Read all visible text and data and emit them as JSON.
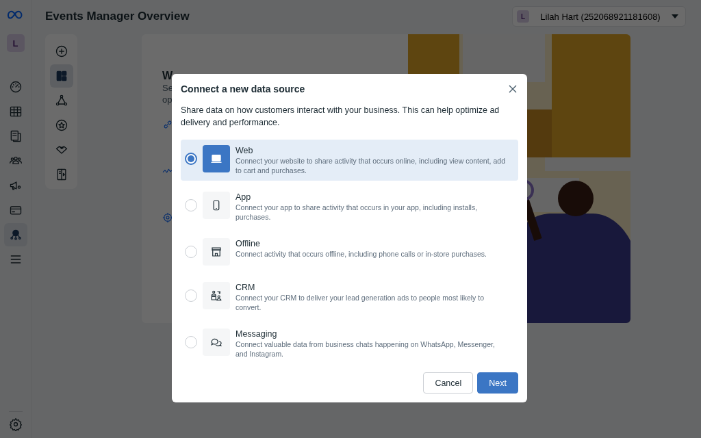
{
  "header": {
    "title": "Events Manager Overview",
    "account": {
      "avatar": "L",
      "name": "Lilah Hart (252068921181608)"
    }
  },
  "sidebar": {
    "avatar": "L",
    "items": [
      {
        "selected": false
      },
      {
        "selected": false
      },
      {
        "selected": false
      },
      {
        "selected": false
      },
      {
        "selected": false
      },
      {
        "selected": false
      },
      {
        "selected": true
      },
      {
        "selected": false
      }
    ]
  },
  "tool_rail": {
    "items": [
      {
        "selected": false
      },
      {
        "selected": true
      },
      {
        "selected": false
      },
      {
        "selected": false
      },
      {
        "selected": false
      },
      {
        "selected": false
      }
    ]
  },
  "welcome_card": {
    "title": "W",
    "lines": [
      "Se",
      "op"
    ]
  },
  "dialog": {
    "title": "Connect a new data source",
    "description": "Share data on how customers interact with your business. This can help optimize ad delivery and performance.",
    "options": [
      {
        "title": "Web",
        "description": "Connect your website to share activity that occurs online, including view content, add to cart and purchases.",
        "selected": true
      },
      {
        "title": "App",
        "description": "Connect your app to share activity that occurs in your app, including installs, purchases.",
        "selected": false
      },
      {
        "title": "Offline",
        "description": "Connect activity that occurs offline, including phone calls or in-store purchases.",
        "selected": false
      },
      {
        "title": "CRM",
        "description": "Connect your CRM to deliver your lead generation ads to people most likely to convert.",
        "selected": false
      },
      {
        "title": "Messaging",
        "description": "Connect valuable data from business chats happening on WhatsApp, Messenger, and Instagram.",
        "selected": false
      }
    ],
    "buttons": [
      "Cancel",
      "Next"
    ]
  }
}
